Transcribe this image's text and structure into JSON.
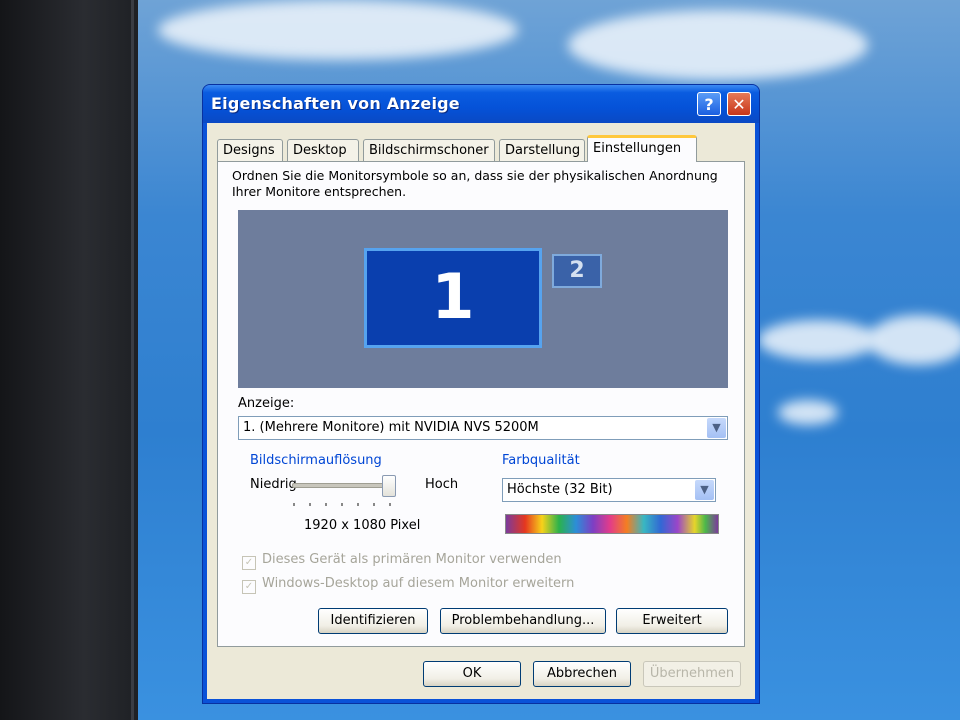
{
  "window": {
    "title": "Eigenschaften von Anzeige",
    "help_label": "?",
    "close_label": "✕"
  },
  "tabs": [
    {
      "label": "Designs"
    },
    {
      "label": "Desktop"
    },
    {
      "label": "Bildschirmschoner"
    },
    {
      "label": "Darstellung"
    },
    {
      "label": "Einstellungen",
      "active": true
    }
  ],
  "settings": {
    "instruction": "Ordnen Sie die Monitorsymbole so an, dass sie der physikalischen Anordnung Ihrer Monitore entsprechen.",
    "monitor1_label": "1",
    "monitor2_label": "2",
    "display_label": "Anzeige:",
    "display_value": "1. (Mehrere Monitore) mit NVIDIA NVS 5200M",
    "resolution_group": "Bildschirmauflösung",
    "resolution_low": "Niedrig",
    "resolution_high": "Hoch",
    "resolution_value": "1920 x 1080 Pixel",
    "resolution_slider_level": 1.0,
    "color_group": "Farbqualität",
    "color_value": "Höchste (32 Bit)",
    "checkbox_primary": "Dieses Gerät als primären Monitor verwenden",
    "checkbox_extend": "Windows-Desktop auf diesem Monitor erweitern",
    "identify_button": "Identifizieren",
    "troubleshoot_button": "Problembehandlung...",
    "advanced_button": "Erweitert"
  },
  "footer": {
    "ok_label": "OK",
    "cancel_label": "Abbrechen",
    "apply_label": "Übernehmen"
  },
  "colors": {
    "titlebar": "#0552d8",
    "monitor_area": "#6e7d9c",
    "monitor_active": "#0a3fae",
    "group_title": "#0046d5"
  }
}
